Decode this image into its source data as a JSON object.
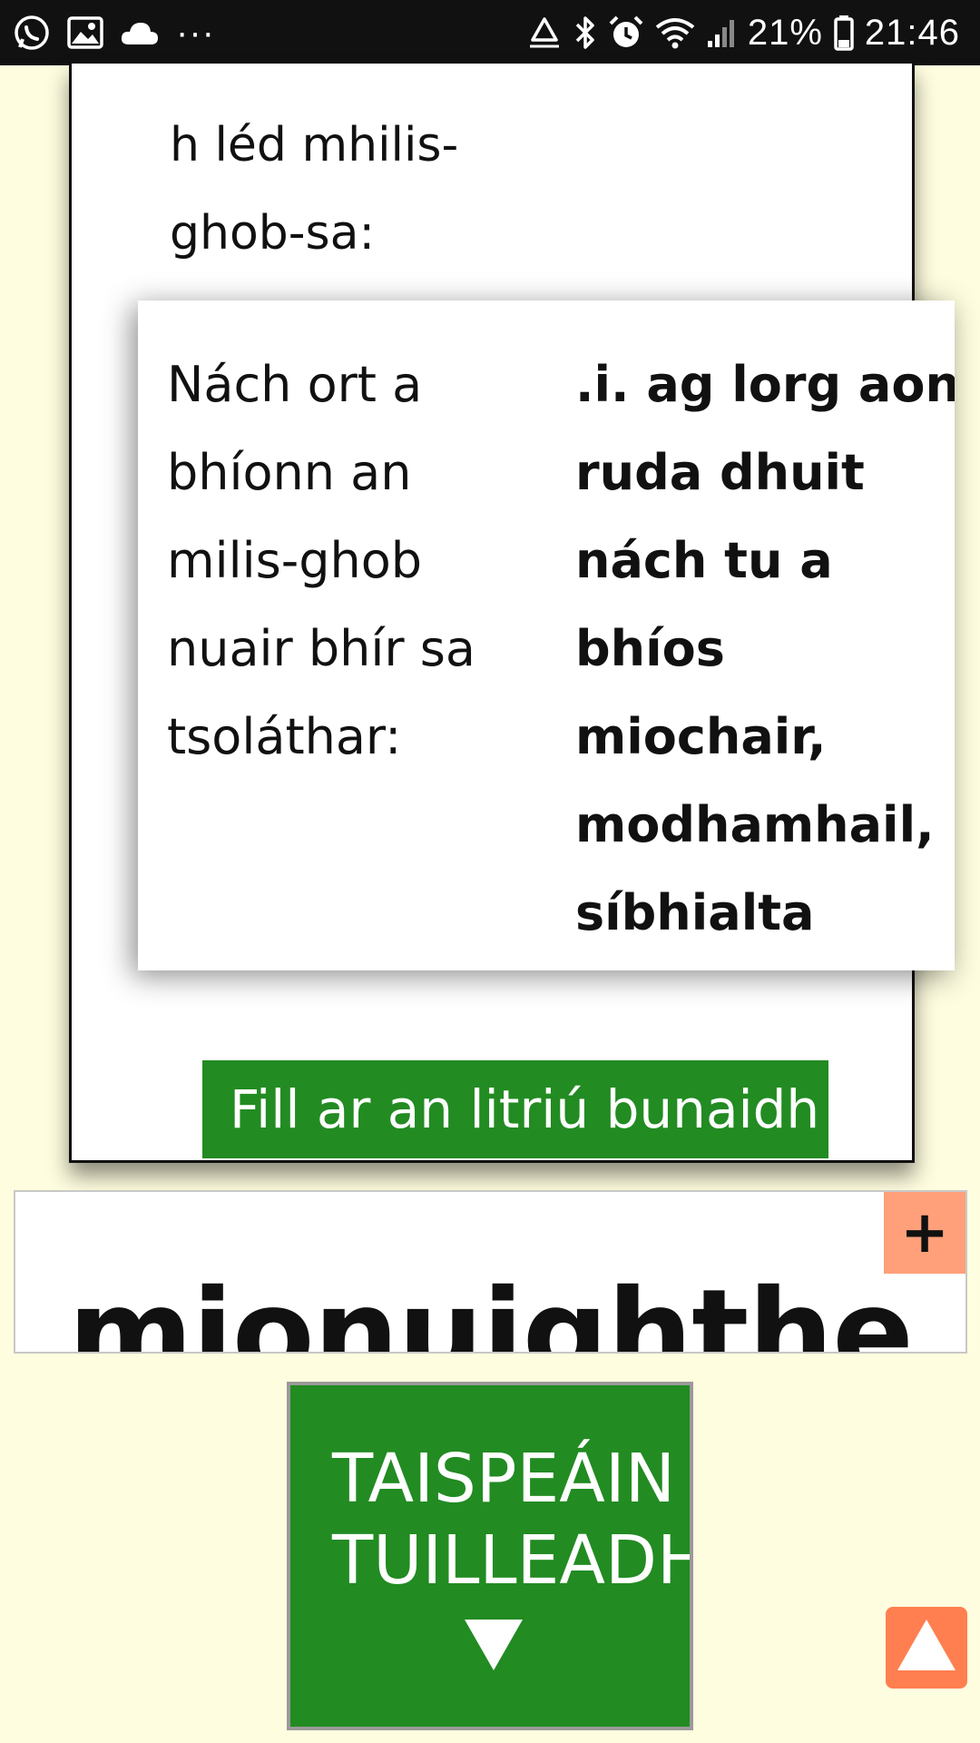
{
  "status_bar": {
    "left_icons": [
      "whatsapp-icon",
      "gallery-icon",
      "cloud-icon",
      "more-dots-icon"
    ],
    "right_icons": [
      "recycle-icon",
      "bluetooth-icon",
      "alarm-icon",
      "wifi-icon",
      "signal-icon",
      "battery-icon"
    ],
    "more_dots": "···",
    "battery_percent": "21%",
    "time": "21:46"
  },
  "entry": {
    "intro_lines": [
      "h léd mhilis-",
      "ghob-sa:"
    ],
    "example": {
      "left_lines": [
        "Nách ort a",
        "bhíonn an",
        "milis-ghob",
        "nuair bhír sa",
        "tsoláthar:"
      ],
      "right_lines": [
        ".i. ag lorg aon",
        "ruda dhuit",
        "nách tu a",
        "bhíos",
        "miochair,",
        "modhamhail,",
        "síbhialta"
      ]
    },
    "restore_button": "Fill ar an litriú bunaidh"
  },
  "word_panel": {
    "headword": "mionuighthe",
    "add_button": "+"
  },
  "show_more": {
    "lines": [
      "TAISPEÁIN",
      "TUILLEADH"
    ],
    "arrow_icon": "triangle-down-icon"
  },
  "scroll_top": {
    "icon": "triangle-up-icon"
  },
  "colors": {
    "page_background": "#fffddf",
    "button_green": "#228b22",
    "accent_salmon": "#ffa07a",
    "accent_coral": "#ff7f50"
  }
}
